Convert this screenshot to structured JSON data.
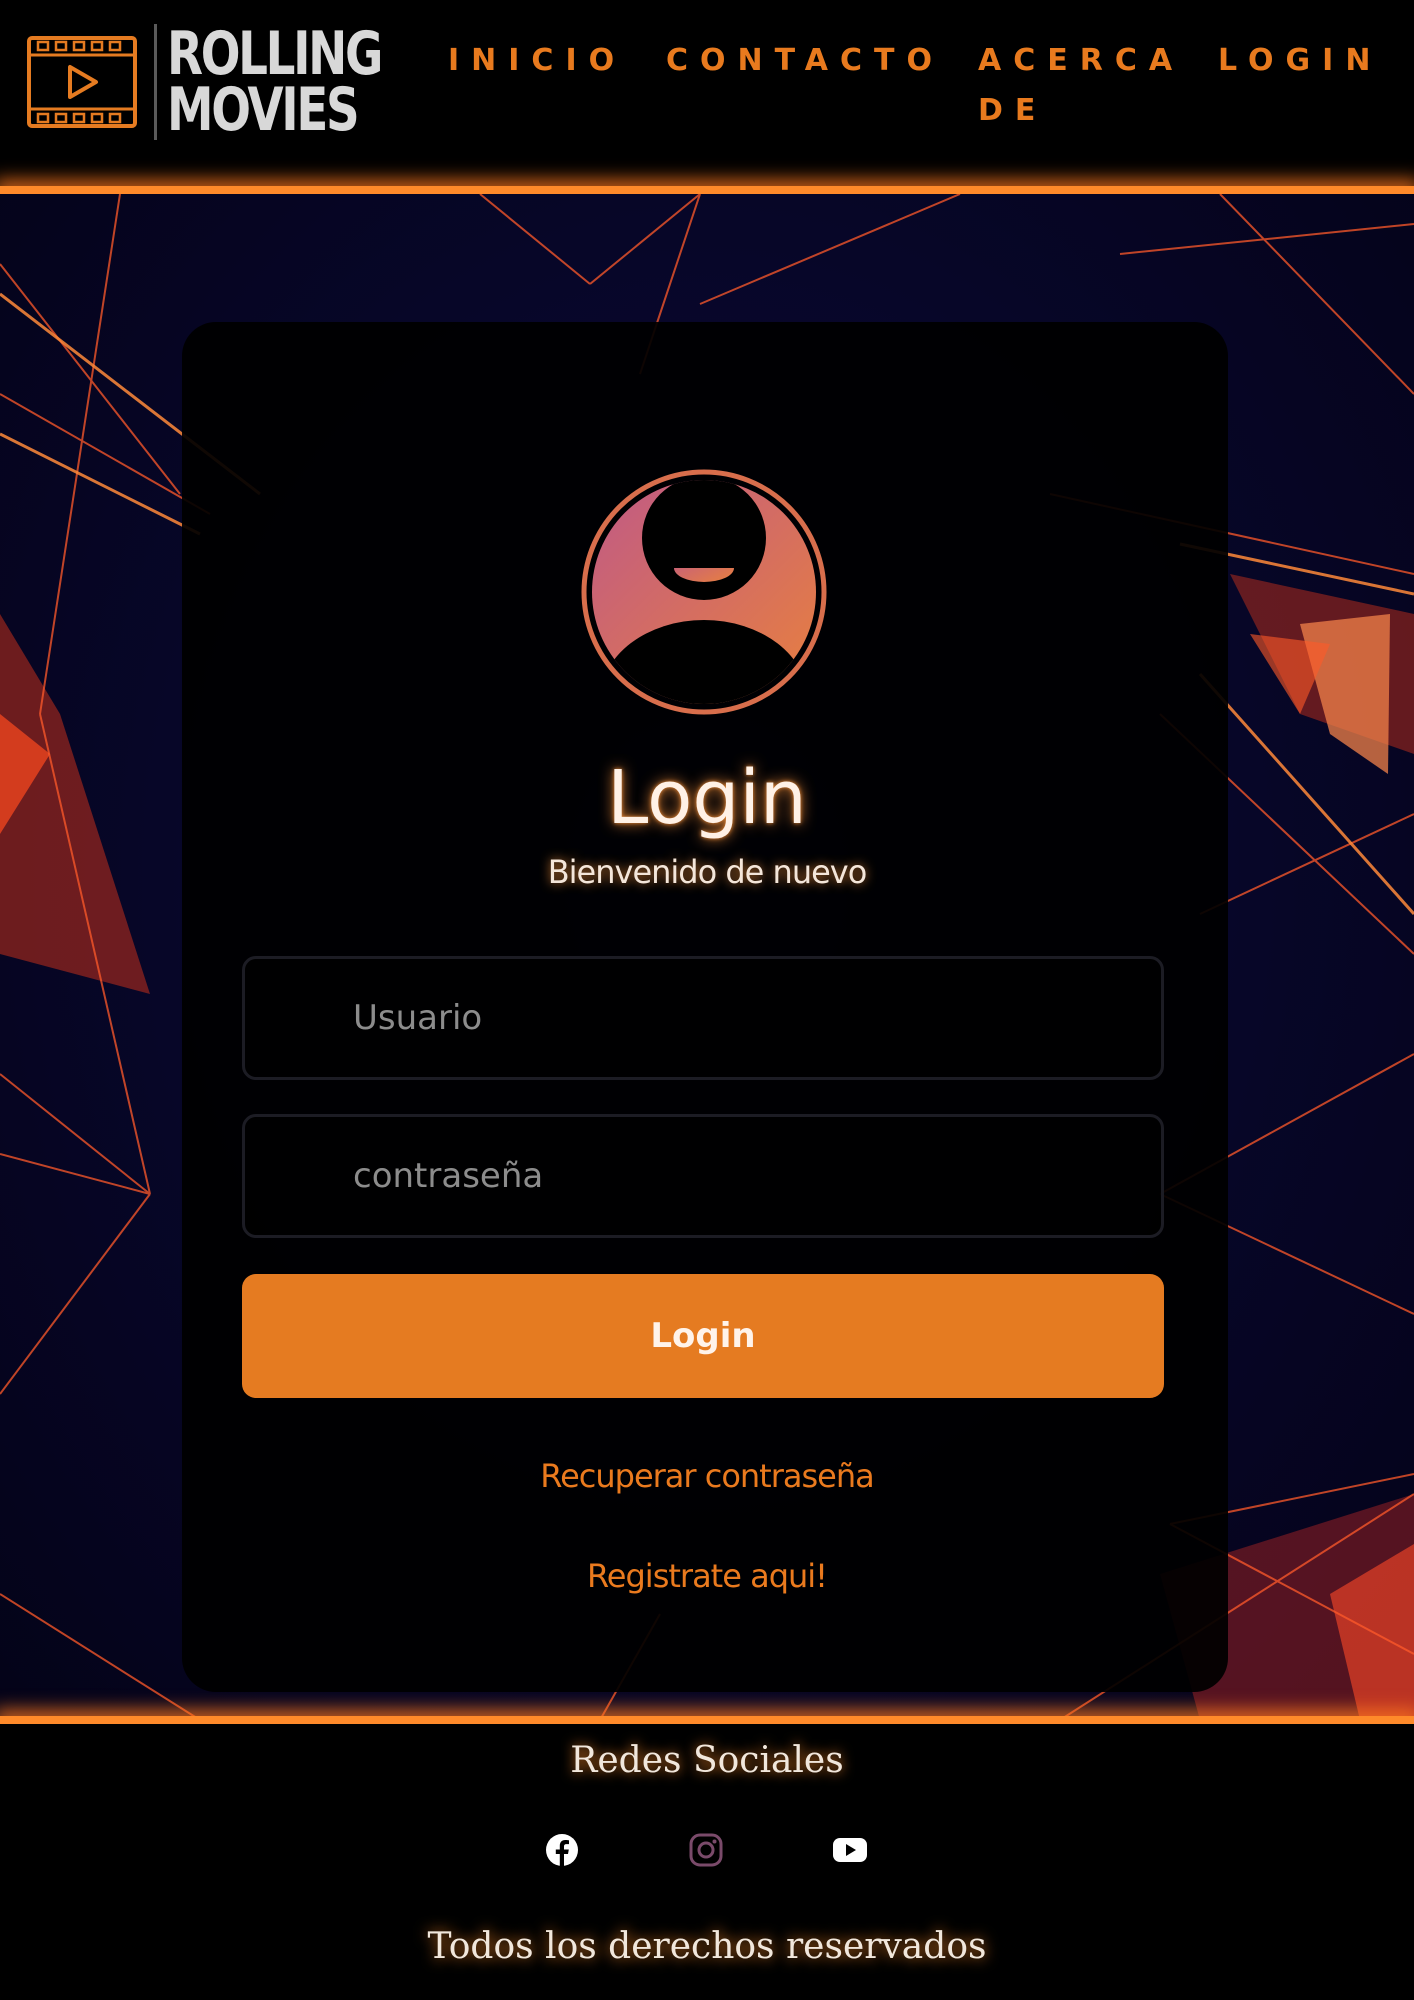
{
  "brand": {
    "line1": "ROLLING",
    "line2": "MOVIES",
    "accent": "#e57b21"
  },
  "nav": {
    "items": [
      {
        "label": "INICIO"
      },
      {
        "label": "CONTACTO"
      },
      {
        "label_line1": "ACERCA",
        "label_line2": "DE"
      },
      {
        "label": "LOGIN"
      }
    ]
  },
  "login": {
    "avatar_icon": "user-avatar-icon",
    "title": "Login",
    "subtitle": "Bienvenido de nuevo",
    "username_placeholder": "Usuario",
    "password_placeholder": "contraseña",
    "submit_label": "Login",
    "recover_link": "Recuperar contraseña",
    "register_link": "Registrate aqui!"
  },
  "footer": {
    "title": "Redes Sociales",
    "social": [
      {
        "icon": "facebook-icon"
      },
      {
        "icon": "instagram-icon"
      },
      {
        "icon": "youtube-icon"
      }
    ],
    "copyright": "Todos los derechos reservados"
  }
}
